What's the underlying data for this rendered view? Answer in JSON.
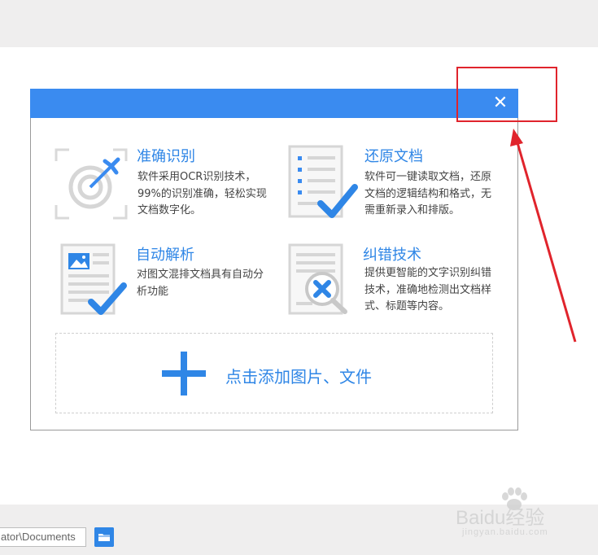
{
  "dialog": {
    "close_glyph": "✕",
    "features": [
      {
        "title": "准确识别",
        "desc": "软件采用OCR识别技术，99%的识别准确，轻松实现文档数字化。",
        "icon": "target-arrow-icon"
      },
      {
        "title": "还原文档",
        "desc": "软件可一键读取文档，还原文档的逻辑结构和格式，无需重新录入和排版。",
        "icon": "document-check-icon"
      },
      {
        "title": "自动解析",
        "desc": "对图文混排文档具有自动分析功能",
        "icon": "image-document-check-icon"
      },
      {
        "title": "纠错技术",
        "desc": "提供更智能的文字识别纠错技术，准确地检测出文档样式、标题等内容。",
        "icon": "document-magnifier-error-icon"
      }
    ],
    "add_label": "点击添加图片、文件"
  },
  "footer": {
    "path_value": "ator\\Documents"
  },
  "watermark": {
    "logo": "Baidu经验",
    "url": "jingyan.baidu.com"
  },
  "colors": {
    "accent": "#3a8bf0",
    "annotation": "#e0242c"
  }
}
